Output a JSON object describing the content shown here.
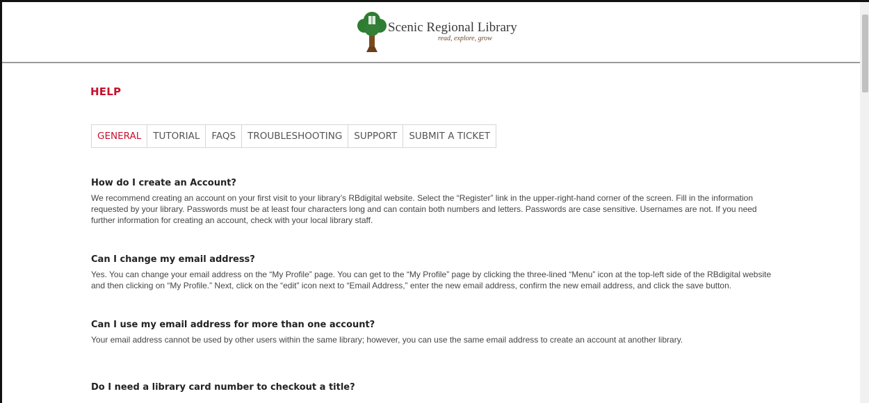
{
  "header": {
    "logo_title": "Scenic Regional Library",
    "logo_tagline": "read, explore, grow"
  },
  "help": {
    "title": "HELP",
    "tabs": [
      {
        "label": "GENERAL",
        "active": true
      },
      {
        "label": "TUTORIAL",
        "active": false
      },
      {
        "label": "FAQS",
        "active": false
      },
      {
        "label": "TROUBLESHOOTING",
        "active": false
      },
      {
        "label": "SUPPORT",
        "active": false
      },
      {
        "label": "SUBMIT A TICKET",
        "active": false
      }
    ]
  },
  "faqs": [
    {
      "question": "How do I create an Account?",
      "answer": "We recommend creating an account on your first visit to your library’s RBdigital website. Select the “Register” link in the upper-right-hand corner of the screen. Fill in the information requested by your library. Passwords must be at least four characters long and can contain both numbers and letters. Passwords are case sensitive. Usernames are not. If you need further information for creating an account, check with your local library staff."
    },
    {
      "question": "Can I change my email address?",
      "answer": "Yes. You can change your email address on the “My Profile” page. You can get to the “My Profile” page by clicking the three-lined “Menu” icon at the top-left side of the RBdigital website and then clicking on “My Profile.” Next, click on the “edit” icon next to “Email Address,” enter the new email address, confirm the new email address, and click the save button."
    },
    {
      "question": "Can I use my email address for more than one account?",
      "answer": "Your email address cannot be used by other users within the same library; however, you can use the same email address to create an account at another library."
    },
    {
      "question": "Do I need a library card number to checkout a title?",
      "answer": ""
    }
  ],
  "colors": {
    "accent": "#c8102e",
    "tree_green": "#2e7d32",
    "trunk_brown": "#7a4a1f"
  }
}
